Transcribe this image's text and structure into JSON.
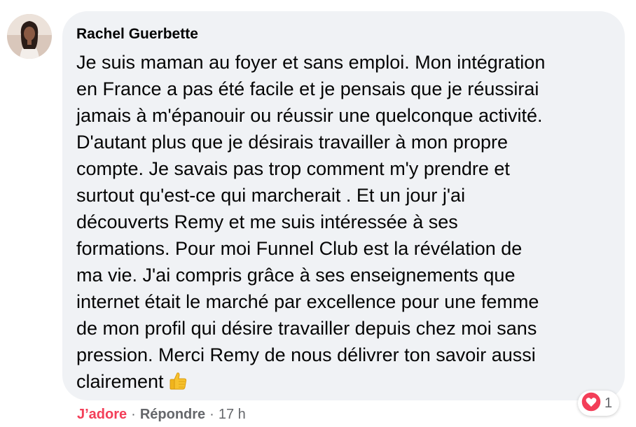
{
  "comment": {
    "author": "Rachel Guerbette",
    "text": "Je suis maman au foyer et sans emploi. Mon intégration\nen France a pas été facile et je pensais que je réussirai\njamais à m'épanouir ou réussir une quelconque activité.\nD'autant plus que je désirais travailler à mon propre\ncompte. Je savais pas trop comment m'y prendre et\nsurtout qu'est-ce qui marcherait . Et un jour j'ai\ndécouverts Remy et me suis intéressée à ses\nformations. Pour moi Funnel Club est la révélation de\nma vie. J'ai compris grâce à ses enseignements que\ninternet était le marché par excellence pour une femme\nde mon profil qui désire travailler depuis chez moi sans\npression. Merci Remy de nous délivrer ton savoir aussi\nclairement",
    "emoji": "thumbs-up-icon"
  },
  "actions": {
    "love_label": "J’adore",
    "separator": "·",
    "reply_label": "Répondre",
    "timestamp": "17 h"
  },
  "reactions": {
    "icon": "heart-icon",
    "count": "1"
  },
  "colors": {
    "bubble": "#f0f2f5",
    "love": "#f33e58",
    "secondary_text": "#65676b"
  }
}
